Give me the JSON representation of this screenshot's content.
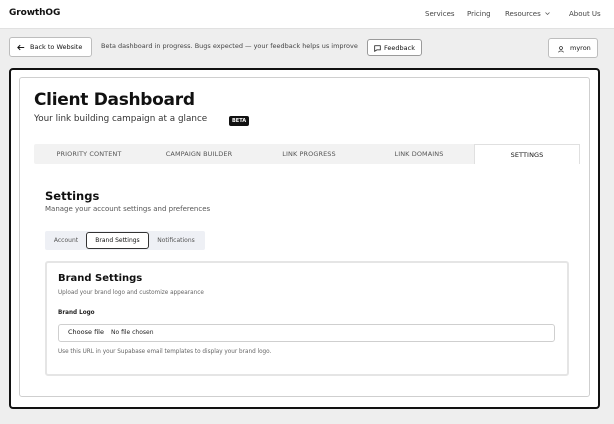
{
  "nav": {
    "brand": "GrowthOG",
    "items": [
      "Services",
      "Pricing",
      "Resources",
      "About Us"
    ]
  },
  "banner": {
    "back_label": "Back to Website",
    "message": "Beta dashboard in progress. Bugs expected — your feedback helps us improve",
    "feedback_label": "Feedback",
    "user_label": "myron"
  },
  "dashboard": {
    "title": "Client Dashboard",
    "subtitle": "Your link building campaign at a glance",
    "badge": "BETA",
    "tabs": [
      "PRIORITY CONTENT",
      "CAMPAIGN BUILDER",
      "LINK PROGRESS",
      "LINK DOMAINS",
      "SETTINGS"
    ],
    "active_tab": "SETTINGS"
  },
  "settings": {
    "title": "Settings",
    "subtitle": "Manage your account settings and preferences",
    "subtabs": [
      "Account",
      "Brand Settings",
      "Notifications"
    ],
    "active_subtab": "Brand Settings"
  },
  "brand": {
    "title": "Brand Settings",
    "subtitle": "Upload your brand logo and customize appearance",
    "logo_label": "Brand Logo",
    "file_button": "Choose file",
    "file_status": "No file chosen",
    "help": "Use this URL in your Supabase email templates to display your brand logo."
  },
  "icons": {
    "back": "arrow-left-icon",
    "feedback": "message-square-icon",
    "user": "user-icon",
    "resources_dropdown": "chevron-down-icon"
  },
  "colors": {
    "frame_border": "#111111",
    "page_bg": "#eeeeee",
    "badge_bg": "#111111"
  }
}
